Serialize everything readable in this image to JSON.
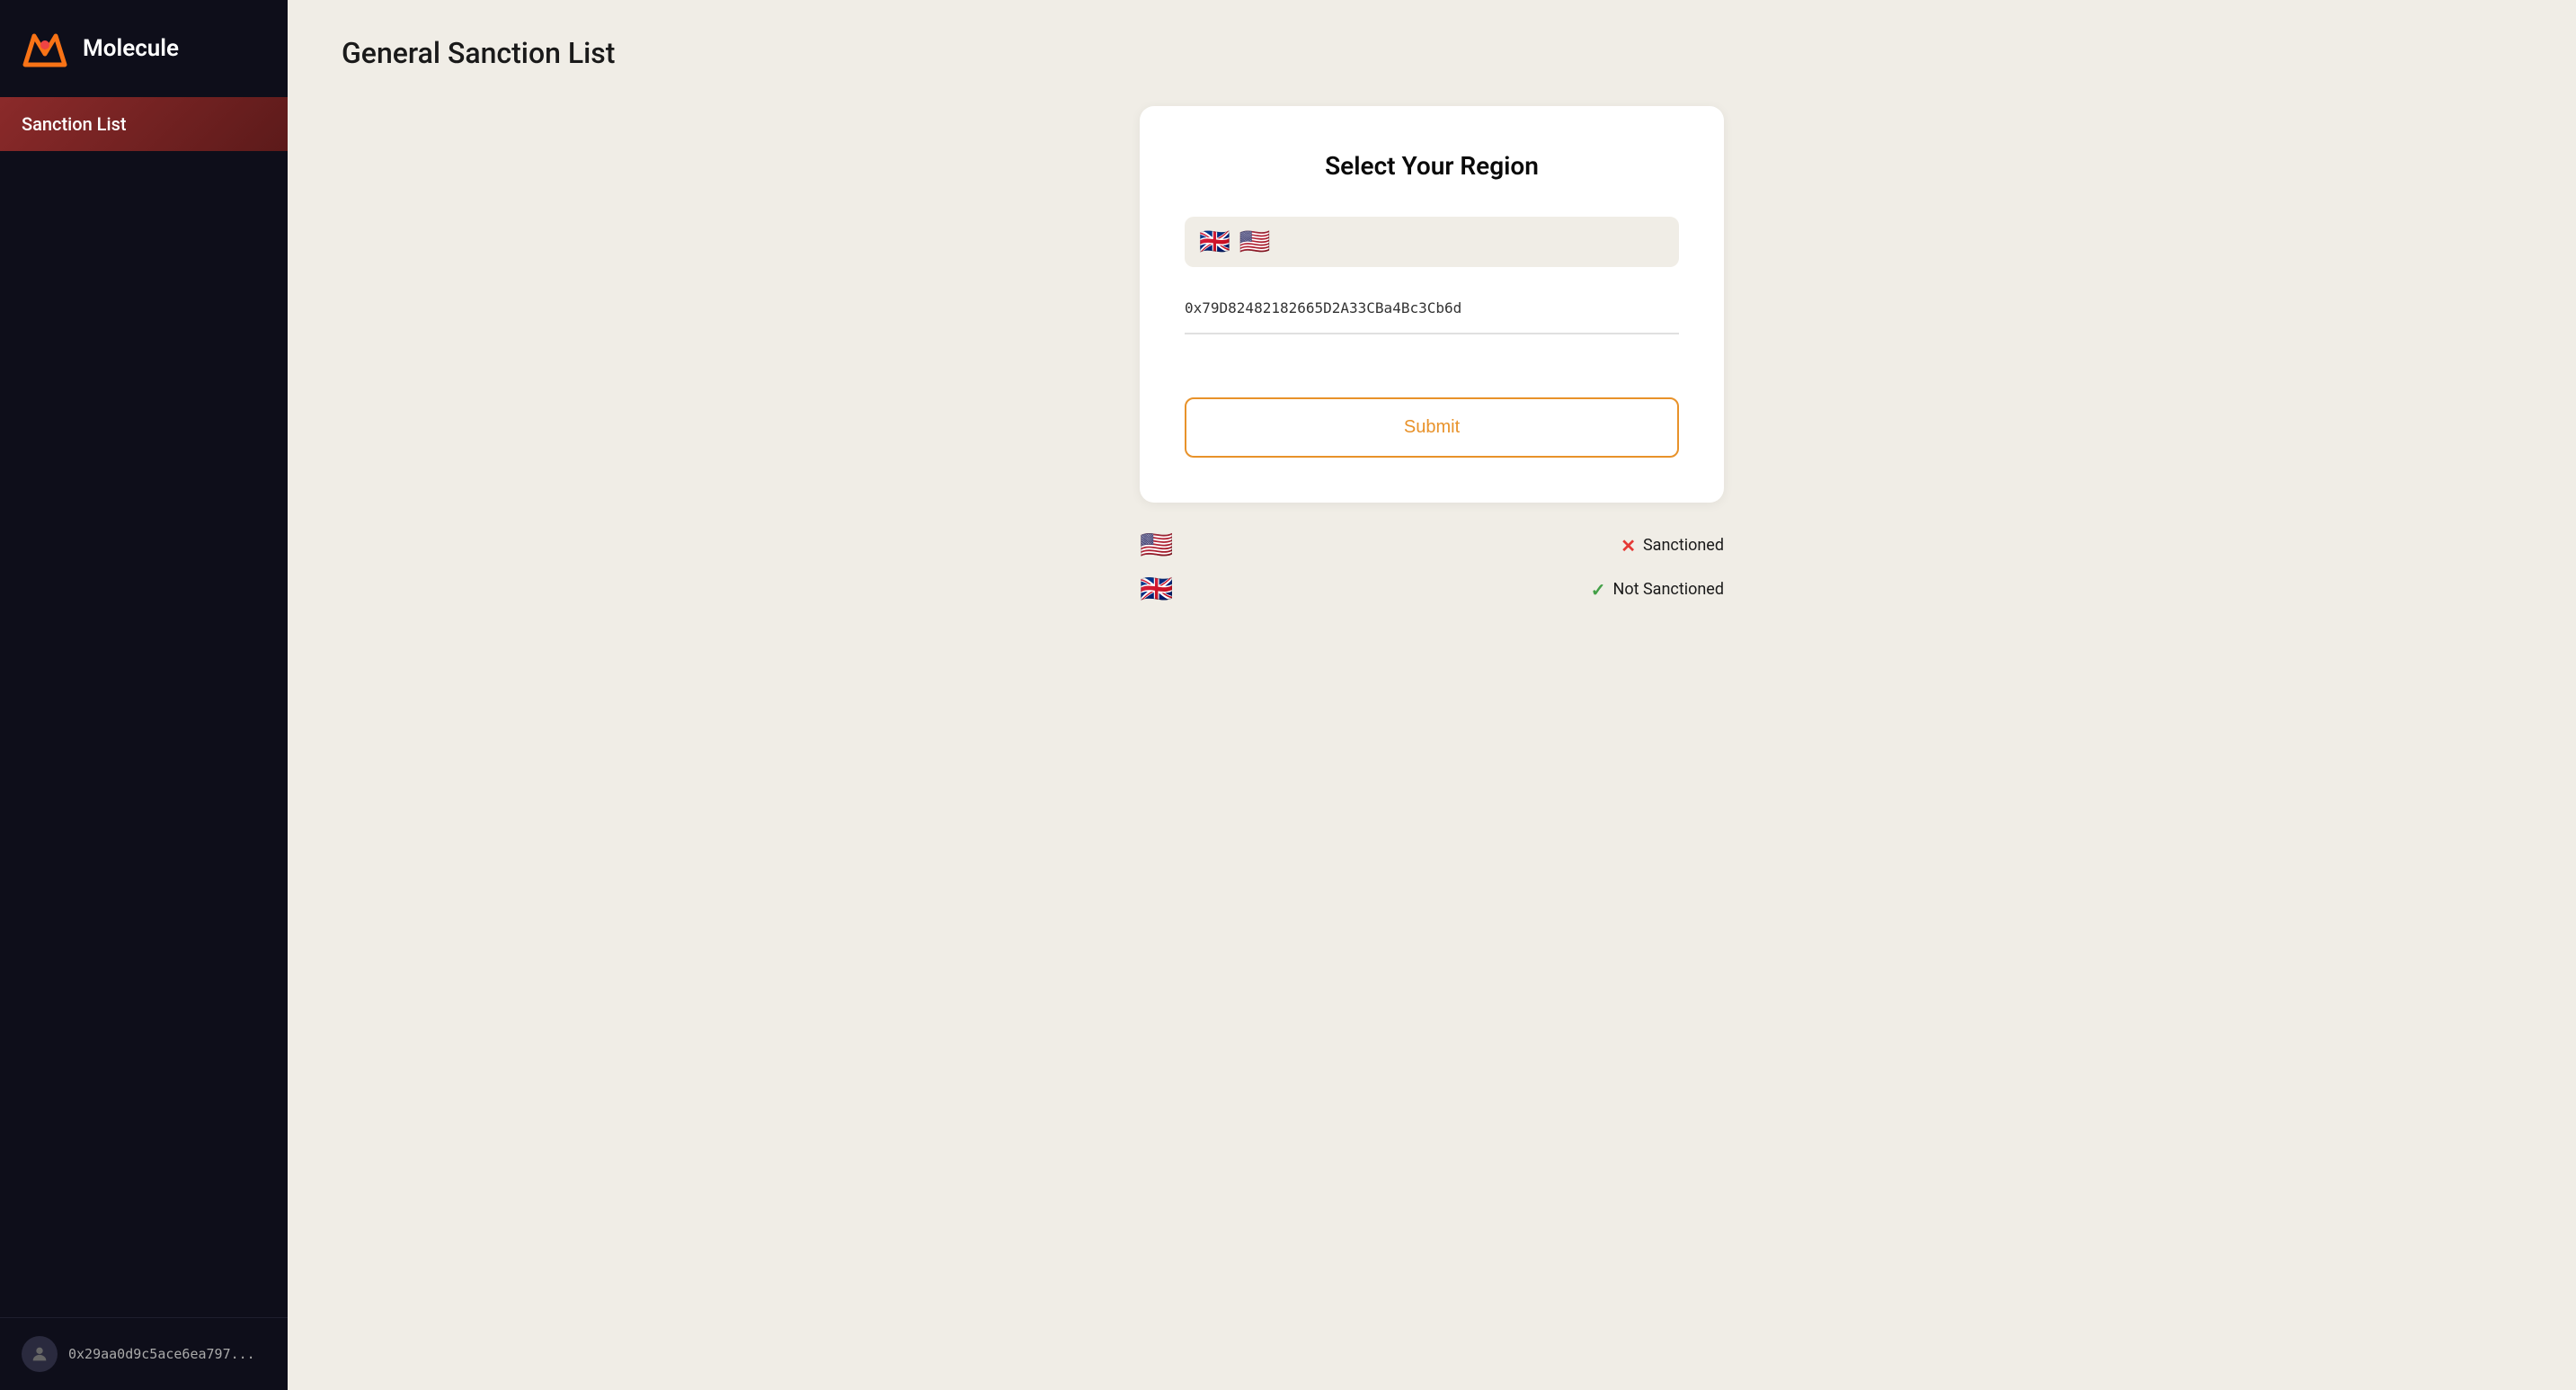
{
  "app": {
    "title": "Molecule",
    "logo_alt": "molecule-logo"
  },
  "sidebar": {
    "items": [
      {
        "label": "Sanction List",
        "active": true
      }
    ],
    "footer": {
      "wallet_address": "0x29aa0d9c5ace6ea797..."
    }
  },
  "main": {
    "page_title": "General Sanction List",
    "card": {
      "title": "Select Your Region",
      "region_flags": [
        "🇬🇧",
        "🇺🇸"
      ],
      "address_value": "0x79D82482182665D2A33CBa4Bc3Cb6d",
      "address_placeholder": "Enter wallet address",
      "submit_label": "Submit"
    },
    "results": [
      {
        "flag": "🇺🇸",
        "status_icon": "x",
        "status_label": "Sanctioned"
      },
      {
        "flag": "🇬🇧",
        "status_icon": "check",
        "status_label": "Not Sanctioned"
      }
    ]
  }
}
